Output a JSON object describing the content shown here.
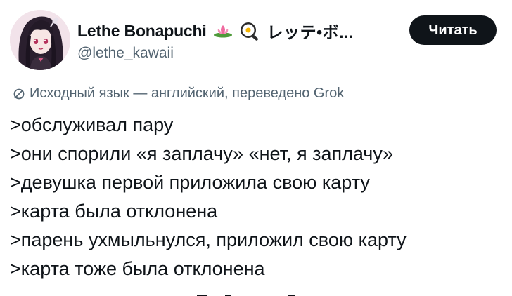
{
  "header": {
    "display_name": "Lethe Bonapuchi",
    "name_suffix": "レッテ•ボ...",
    "handle": "@lethe_kawaii",
    "emojis": [
      "lotus-icon",
      "frying-pan-egg-icon"
    ],
    "follow_label": "Читать",
    "follow_bg": "#0f1419"
  },
  "translation": {
    "icon": "translate-icon",
    "text": "Исходный язык — английский, переведено Grok"
  },
  "tweet": {
    "lines": [
      ">обслуживал пару",
      ">они спорили «я заплачу» «нет, я заплачу»",
      ">девушка первой приложила свою карту",
      ">карта была отклонена",
      ">парень ухмыльнулся, приложил свою карту",
      ">карта тоже была отклонена"
    ]
  },
  "colors": {
    "text": "#0f1419",
    "secondary": "#536471",
    "background": "#ffffff"
  }
}
